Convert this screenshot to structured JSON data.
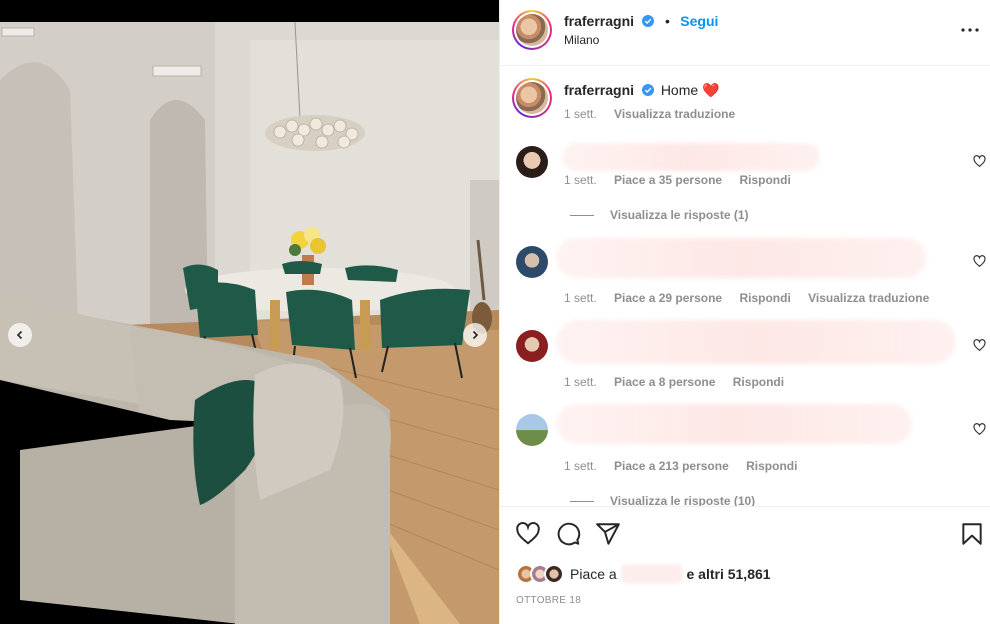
{
  "post": {
    "username": "fraferragni",
    "follow_label": "Segui",
    "location": "Milano",
    "caption_text": "Home",
    "caption_emoji": "❤️",
    "caption_time": "1 sett.",
    "translate_label": "Visualizza traduzione"
  },
  "comments": [
    {
      "time": "1 sett.",
      "likes": "Piace a 35 persone",
      "reply": "Rispondi",
      "view_replies": "Visualizza le risposte (1)"
    },
    {
      "time": "1 sett.",
      "likes": "Piace a 29 persone",
      "reply": "Rispondi",
      "translate": "Visualizza traduzione"
    },
    {
      "time": "1 sett.",
      "likes": "Piace a 8 persone",
      "reply": "Rispondi"
    },
    {
      "time": "1 sett.",
      "likes": "Piace a 213 persone",
      "reply": "Rispondi",
      "view_replies": "Visualizza le risposte (10)"
    }
  ],
  "footer": {
    "likes_prefix": "Piace a",
    "likes_suffix": "e altri 51,861",
    "date": "OTTOBRE 18"
  },
  "icons": {
    "like": "heart-icon",
    "comment": "comment-icon",
    "share": "share-icon",
    "save": "bookmark-icon",
    "more": "more-options-icon",
    "verified": "verified-badge-icon"
  },
  "colors": {
    "accent": "#0095f6",
    "text": "#262626",
    "muted": "#8e8e8e",
    "divider": "#efefef",
    "verified": "#3897f0"
  }
}
